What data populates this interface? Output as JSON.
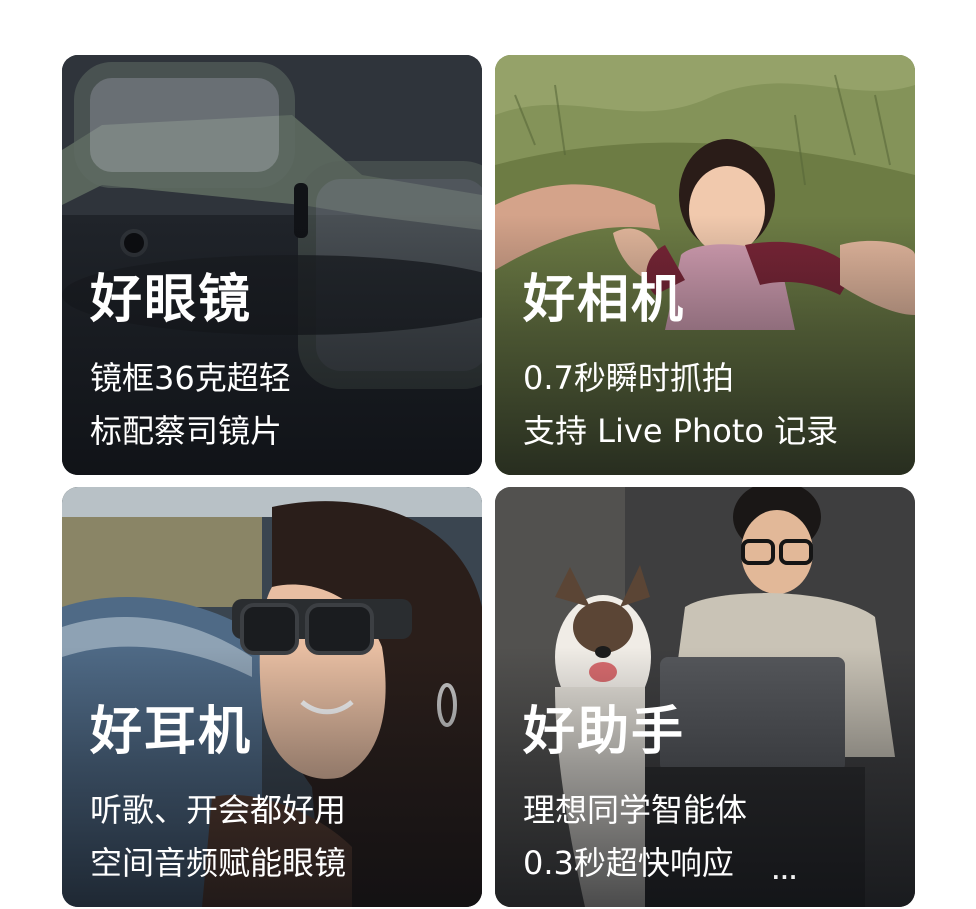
{
  "cards": [
    {
      "title": "好眼镜",
      "line1": "镜框36克超轻",
      "line2": "标配蔡司镜片"
    },
    {
      "title": "好相机",
      "line1": "0.7秒瞬时抓拍",
      "line2": "支持 Live Photo 记录"
    },
    {
      "title": "好耳机",
      "line1": "听歌、开会都好用",
      "line2": "空间音频赋能眼镜"
    },
    {
      "title": "好助手",
      "line1": "理想同学智能体",
      "line2": "0.3秒超快响应"
    }
  ],
  "watermark": "..."
}
